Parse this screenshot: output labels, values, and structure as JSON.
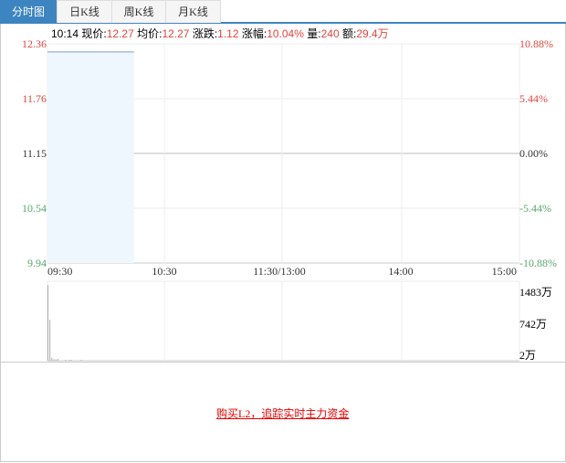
{
  "tabs": [
    {
      "label": "分时图",
      "active": true
    },
    {
      "label": "日K线"
    },
    {
      "label": "周K线"
    },
    {
      "label": "月K线"
    }
  ],
  "info": {
    "time": "10:14",
    "price_label": "现价:",
    "price": "12.27",
    "avg_label": "均价:",
    "avg": "12.27",
    "change_label": "涨跌:",
    "change": "1.12",
    "pct_label": "涨幅:",
    "pct": "10.04%",
    "vol_label": "量:",
    "vol": "240",
    "amt_label": "额:",
    "amt": "29.4万"
  },
  "promo": {
    "link": "购买L2，追踪实时主力资金"
  },
  "colors": {
    "up": "#e2453c",
    "down": "#5aa66e",
    "accent": "#3d85c0",
    "line": "#7f9fbf",
    "fill": "#eef7fd"
  },
  "chart_data": {
    "type": "line",
    "price_axis": {
      "ylim": [
        9.94,
        12.36
      ],
      "ticks": [
        "12.36",
        "11.76",
        "11.15",
        "10.54",
        "9.94"
      ],
      "pct_ticks": [
        "10.88%",
        "5.44%",
        "0.00%",
        "-5.44%",
        "-10.88%"
      ],
      "prev_close": 11.15
    },
    "x_ticks": [
      "09:30",
      "10:30",
      "11:30/13:00",
      "14:00",
      "15:00"
    ],
    "price_series": {
      "x": [
        "09:30",
        "10:14"
      ],
      "values": [
        12.27,
        12.27
      ]
    },
    "volume_axis": {
      "ticks": [
        "1483万",
        "742万",
        "2万"
      ],
      "ylim": [
        2,
        1483
      ]
    },
    "volume_series": {
      "x_minutes": [
        0,
        1,
        2,
        3,
        4,
        5,
        9,
        11,
        12,
        17
      ],
      "values": [
        1483,
        800,
        60,
        30,
        25,
        35,
        8,
        6,
        6,
        15
      ]
    }
  }
}
